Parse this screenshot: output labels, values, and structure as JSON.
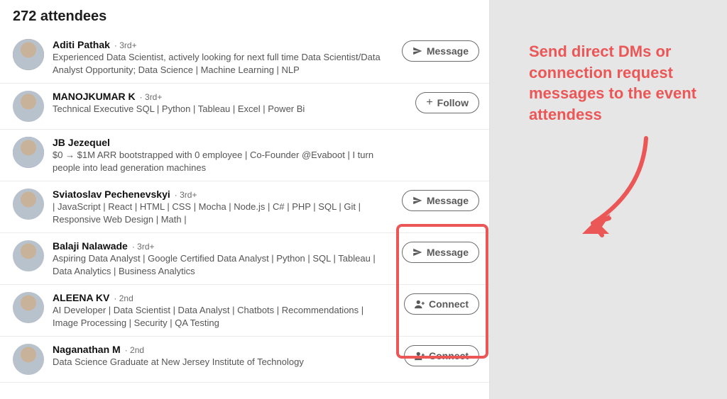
{
  "header": {
    "title": "272 attendees"
  },
  "action_labels": {
    "message": "Message",
    "follow": "Follow",
    "connect": "Connect"
  },
  "annotation": {
    "text": "Send direct DMs or connection request messages to the event attendess"
  },
  "attendees": [
    {
      "name": "Aditi Pathak",
      "degree": "3rd+",
      "headline": "Experienced Data Scientist, actively looking for next full time Data Scientist/Data Analyst Opportunity; Data Science | Machine Learning | NLP",
      "action": "message",
      "avatar_bg": "bg1"
    },
    {
      "name": "MANOJKUMAR K",
      "degree": "3rd+",
      "headline": "Technical Executive SQL | Python | Tableau | Excel | Power Bi",
      "action": "follow",
      "avatar_bg": "bg2"
    },
    {
      "name": "JB Jezequel",
      "degree": "",
      "headline": "$0 → $1M ARR bootstrapped with 0 employee | Co-Founder @Evaboot | I turn people into lead generation machines",
      "action": "",
      "avatar_bg": "bg3"
    },
    {
      "name": "Sviatoslav Pechenevskyi",
      "degree": "3rd+",
      "headline": "| JavaScript | React | HTML | CSS | Mocha | Node.js | C# | PHP | SQL | Git | Responsive Web Design | Math |",
      "action": "message",
      "avatar_bg": "bg4"
    },
    {
      "name": "Balaji Nalawade",
      "degree": "3rd+",
      "headline": "Aspiring Data Analyst | Google Certified Data Analyst | Python | SQL | Tableau | Data Analytics | Business Analytics",
      "action": "message",
      "avatar_bg": "bg5"
    },
    {
      "name": "ALEENA KV",
      "degree": "2nd",
      "headline": "AI Developer | Data Scientist | Data Analyst | Chatbots | Recommendations | Image Processing | Security | QA Testing",
      "action": "connect",
      "avatar_bg": "bg6"
    },
    {
      "name": "Naganathan M",
      "degree": "2nd",
      "headline": "Data Science Graduate at New Jersey Institute of Technology",
      "action": "connect",
      "avatar_bg": "bg7"
    }
  ]
}
